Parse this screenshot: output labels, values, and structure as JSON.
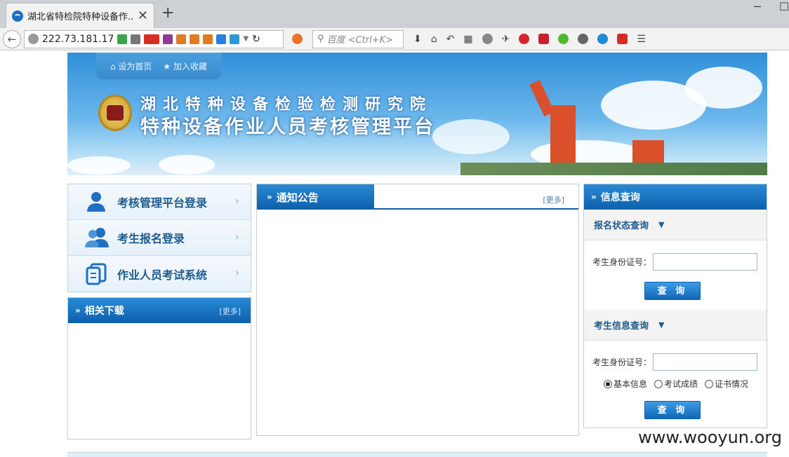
{
  "browser": {
    "tab_title": "湖北省特检院特种设备作...",
    "url": "222.73.181.17",
    "search_placeholder": "百度 <Ctrl+K>",
    "new_tab": "+",
    "close_tab": "✕",
    "back": "←",
    "reload": "↻",
    "min_btn": "─",
    "restore_btn": "☐"
  },
  "header": {
    "set_home": "设为首页",
    "add_fav": "加入收藏",
    "org_name": "湖北特种设备检验检测研究院",
    "platform_name": "特种设备作业人员考核管理平台"
  },
  "login_links": [
    {
      "label": "考核管理平台登录",
      "icon": "person-icon"
    },
    {
      "label": "考生报名登录",
      "icon": "group-icon"
    },
    {
      "label": "作业人员考试系统",
      "icon": "document-icon"
    }
  ],
  "downloads": {
    "title": "相关下载",
    "more": "[更多]"
  },
  "notice": {
    "title": "通知公告",
    "more": "[更多]"
  },
  "query": {
    "title": "信息查询",
    "status_section": "报名状态查询",
    "info_section": "考生信息查询",
    "id_label": "考生身份证号：",
    "button": "查 询",
    "id_value_1": "",
    "id_value_2": "",
    "radios": [
      {
        "label": "基本信息",
        "checked": true
      },
      {
        "label": "考试成绩",
        "checked": false
      },
      {
        "label": "证书情况",
        "checked": false
      }
    ]
  },
  "watermark": "www.wooyun.org",
  "colors": {
    "brand_blue": "#0d5fab",
    "link_blue": "#1e5a8e"
  }
}
